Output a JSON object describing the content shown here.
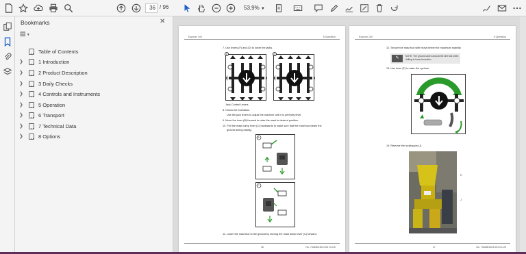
{
  "toolbar": {
    "page_current": "36",
    "page_total": "/ 96",
    "zoom": "53,9%"
  },
  "panel": {
    "title": "Bookmarks",
    "items": [
      {
        "label": "Table of Contents",
        "expandable": false
      },
      {
        "label": "1 Introduction",
        "expandable": true
      },
      {
        "label": "2 Product Description",
        "expandable": true
      },
      {
        "label": "3 Daily Checks",
        "expandable": true
      },
      {
        "label": "4 Controls and Instruments",
        "expandable": true
      },
      {
        "label": "5 Operation",
        "expandable": true
      },
      {
        "label": "6 Transport",
        "expandable": true
      },
      {
        "label": "7 Technical Data",
        "expandable": true
      },
      {
        "label": "8 Options",
        "expandable": true
      }
    ]
  },
  "left_page": {
    "header_left": "Explorer 100",
    "header_right": "5 Operation",
    "step7": "7.    Use levers (F) and (D) to lower the jacks.",
    "caption": "Jack Control Levers",
    "step8": "8.    Check the inclination.",
    "step8b": "Use the jack levers to adjust the machine until it is perfectly level.",
    "step9": "9.    Move the lever (B) forward to raise the mast to desired position.",
    "step10": "10.   Pull the mast dump lever (C) backwards to make sure that the mast foot clears the",
    "step10b": "ground during raising.",
    "step11": "11.   Lower the mast foot to the ground by moving the mast dump lever (C) forward.",
    "footer_num": "36",
    "footer_doc": "No. 7332801403.004 en-US",
    "fig_b": "B",
    "fig_c": "C",
    "fig_f": "F",
    "fig_d": "D"
  },
  "right_page": {
    "header_left": "Explorer 100",
    "header_right": "5 Operation",
    "step12": "12.   Secure the mast foot with heavy timber for maximum stability.",
    "note": "NOTE: The ground caves around the drill foot when drilling in loose formation.",
    "step13": "13.   Use lever (F) to raise the cyclone.",
    "step14": "14.   Remove the locking pin (J).",
    "footer_num": "37",
    "footer_doc": "No. 7332801403.004 en-US",
    "label_h": "H",
    "label_j": "J"
  }
}
